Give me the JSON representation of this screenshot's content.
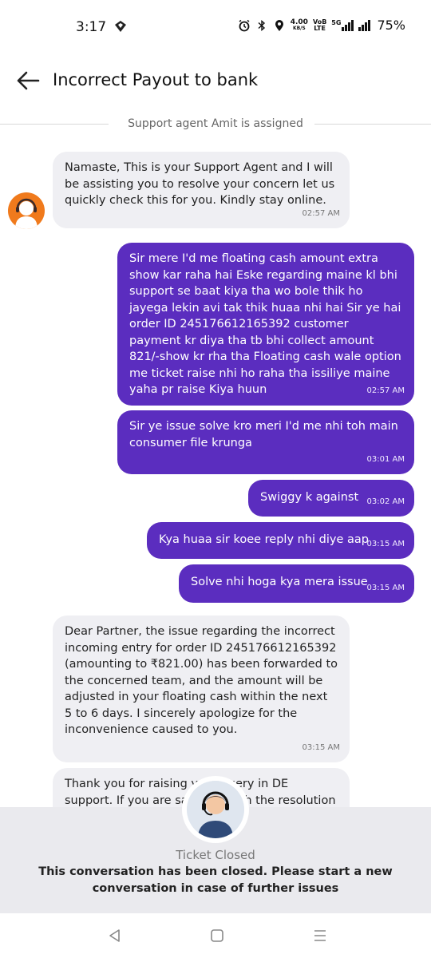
{
  "status_bar": {
    "time": "3:17",
    "speed_top": "4.00",
    "speed_unit": "KB/S",
    "volte_top": "VoB",
    "volte_bottom": "LTE",
    "net_type": "5G",
    "battery": "75%"
  },
  "header": {
    "title": "Incorrect Payout to bank"
  },
  "chat": {
    "assigned_text": "Support agent Amit is assigned",
    "messages": [
      {
        "from": "agent",
        "text": "Namaste, This is your Support Agent and I will be assisting you to resolve your concern let us quickly check this for you. Kindly stay online.",
        "time": "02:57 AM"
      },
      {
        "from": "user",
        "text": "Sir mere I'd me floating cash amount extra show kar raha hai Eske regarding maine kl bhi support se baat kiya tha wo bole thik ho jayega lekin avi tak thik huaa nhi hai Sir ye hai order ID 245176612165392 customer payment kr diya tha tb bhi collect amount 821/-show kr rha tha Floating cash wale option me ticket raise nhi ho raha tha issiliye maine yaha pr raise Kiya huun",
        "time": "02:57 AM"
      },
      {
        "from": "user",
        "text": "Sir ye issue solve kro meri I'd me nhi toh main consumer file krunga",
        "time": "03:01 AM"
      },
      {
        "from": "user",
        "text": "Swiggy k against",
        "time": "03:02 AM"
      },
      {
        "from": "user",
        "text": "Kya huaa sir koee reply nhi diye aap",
        "time": "03:15 AM"
      },
      {
        "from": "user",
        "text": "Solve nhi hoga kya mera issue",
        "time": "03:15 AM"
      },
      {
        "from": "agent",
        "text": "Dear Partner, the issue regarding the incorrect incoming entry for order ID 245176612165392 (amounting to ₹821.00) has been forwarded to the concerned team, and the amount will be adjusted in your floating cash within the next 5 to 6 days. I sincerely apologize for the inconvenience caused to you.",
        "time": "03:15 AM"
      },
      {
        "from": "agent",
        "text": "Thank you for raising your query in DE support. If you are satisfied with the resolution given by",
        "time": ""
      }
    ]
  },
  "closed": {
    "label": "Ticket Closed",
    "message": "This conversation has been closed. Please start a new conversation in case of further issues"
  },
  "colors": {
    "user_bubble": "#5b2dbf",
    "agent_bubble": "#efeff3",
    "agent_avatar": "#f07a1c"
  }
}
